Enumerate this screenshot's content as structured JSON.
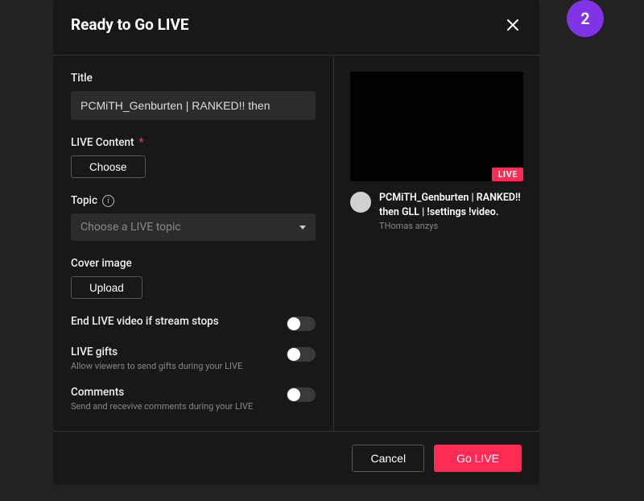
{
  "step_badge": "2",
  "modal": {
    "title": "Ready to Go LIVE",
    "form": {
      "title_label": "Title",
      "title_value": "PCMiTH_Genburten | RANKED!! then",
      "live_content_label": "LIVE Content",
      "live_content_required": "*",
      "choose_button": "Choose",
      "topic_label": "Topic",
      "topic_placeholder": "Choose a LIVE topic",
      "cover_label": "Cover image",
      "upload_button": "Upload",
      "toggles": [
        {
          "label": "End LIVE video if stream stops",
          "sub": ""
        },
        {
          "label": "LIVE gifts",
          "sub": "Allow viewers to send gifts during your LIVE"
        },
        {
          "label": "Comments",
          "sub": "Send and recevive comments during your LIVE"
        }
      ]
    },
    "preview": {
      "live_badge": "LIVE",
      "title": "PCMiTH_Genburten | RANKED!! then GLL | !settings !video.",
      "user": "THomas anzys"
    },
    "footer": {
      "cancel": "Cancel",
      "go_live": "Go LIVE"
    }
  }
}
